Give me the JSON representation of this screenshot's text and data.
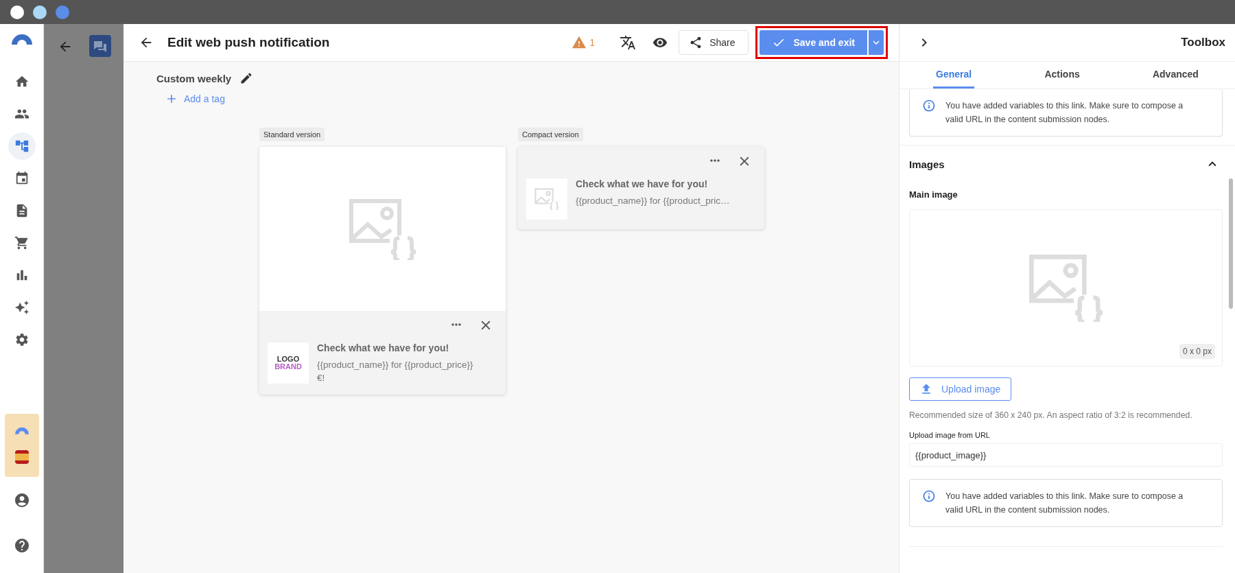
{
  "window": {
    "controls": [
      {
        "color": "#ffffff"
      },
      {
        "color": "#a9d9f7"
      },
      {
        "color": "#5a8de8"
      }
    ]
  },
  "sidebar": {
    "items": [
      {
        "kind": "home",
        "selected": false
      },
      {
        "kind": "people",
        "selected": false
      },
      {
        "kind": "journey",
        "selected": true
      },
      {
        "kind": "calendar",
        "selected": false
      },
      {
        "kind": "document",
        "selected": false
      },
      {
        "kind": "cart",
        "selected": false
      },
      {
        "kind": "chart",
        "selected": false
      },
      {
        "kind": "sparkles",
        "selected": false
      },
      {
        "kind": "settings",
        "selected": false
      }
    ],
    "footer": [
      {
        "kind": "account"
      },
      {
        "kind": "help"
      }
    ]
  },
  "editor": {
    "title": "Edit web push notification",
    "warnings": "1",
    "share": "Share",
    "save": "Save and exit",
    "highlighted": true,
    "name": "Custom weekly",
    "add_tag": "Add a tag"
  },
  "previews": [
    {
      "kind": "standard",
      "label": "Standard version",
      "title": "Check what we have for you!",
      "body": "{{product_name}} for {{product_price}} €!",
      "logo": [
        "LOGO",
        "BRAND"
      ]
    },
    {
      "kind": "compact",
      "label": "Compact version",
      "title": "Check what we have for you!",
      "body": "{{product_name}} for {{product_pric…"
    }
  ],
  "toolbox": {
    "title": "Toolbox",
    "tabs": [
      {
        "label": "General",
        "selected": true
      },
      {
        "label": "Actions",
        "selected": false
      },
      {
        "label": "Advanced",
        "selected": false
      }
    ],
    "notice": "You have added variables to this link. Make sure to compose a valid URL in the content submission nodes.",
    "section": {
      "title": "Images",
      "expanded": true
    },
    "main_image_label": "Main image",
    "dimensions": "0 x 0 px",
    "upload": "Upload image",
    "hint": "Recommended size of 360 x 240 px. An aspect ratio of 3:2 is recommended.",
    "url_label": "Upload image from URL",
    "url_value": "{{product_image}}",
    "notice2": "You have added variables to this link. Make sure to compose a valid URL in the content submission nodes."
  }
}
